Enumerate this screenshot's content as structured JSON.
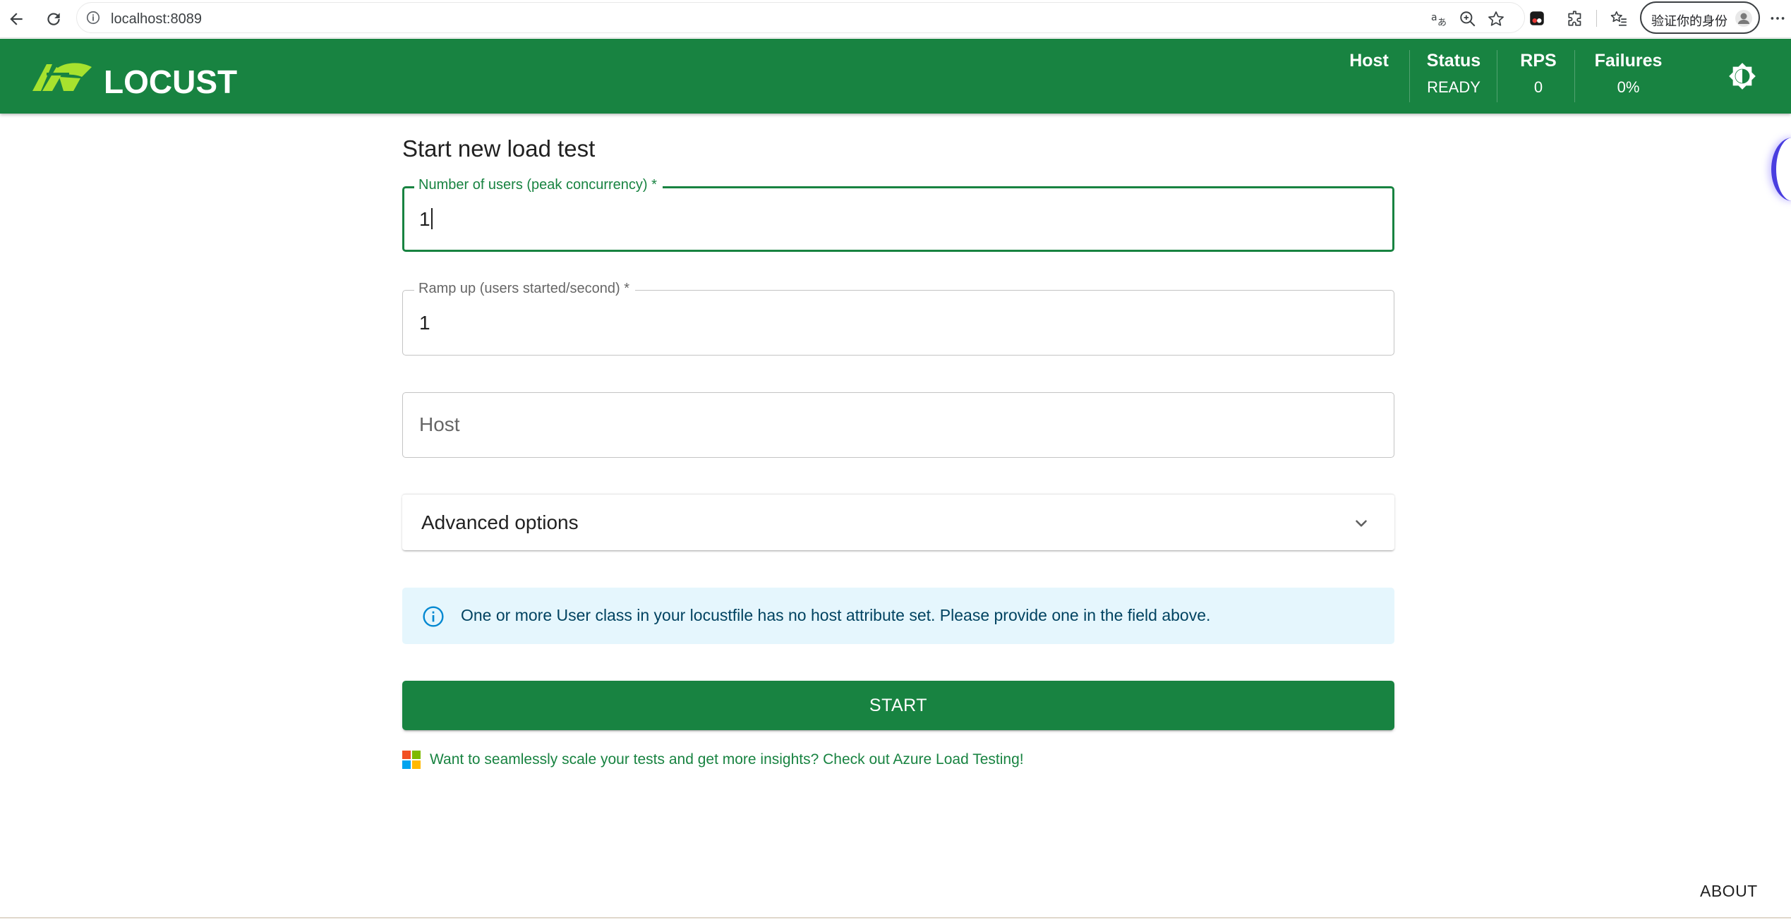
{
  "browser": {
    "url": "localhost:8089",
    "verify_identity_label": "验证你的身份"
  },
  "header": {
    "logo_text": "LOCUST",
    "stats": [
      {
        "title": "Host",
        "value": ""
      },
      {
        "title": "Status",
        "value": "READY"
      },
      {
        "title": "RPS",
        "value": "0"
      },
      {
        "title": "Failures",
        "value": "0%"
      }
    ]
  },
  "form": {
    "title": "Start new load test",
    "users": {
      "label": "Number of users (peak concurrency) *",
      "value": "1"
    },
    "ramp_up": {
      "label": "Ramp up (users started/second) *",
      "value": "1"
    },
    "host": {
      "placeholder": "Host",
      "value": ""
    },
    "advanced_label": "Advanced options",
    "alert_text": "One or more User class in your locustfile has no host attribute set. Please provide one in the field above.",
    "start_label": "START",
    "azure_text": "Want to seamlessly scale your tests and get more insights? Check out Azure Load Testing!"
  },
  "footer": {
    "about_label": "ABOUT"
  },
  "colors": {
    "brand_green": "#188341",
    "logo_lime": "#a7e22e",
    "info_bg": "#e5f6fd",
    "info_text": "#014361"
  }
}
